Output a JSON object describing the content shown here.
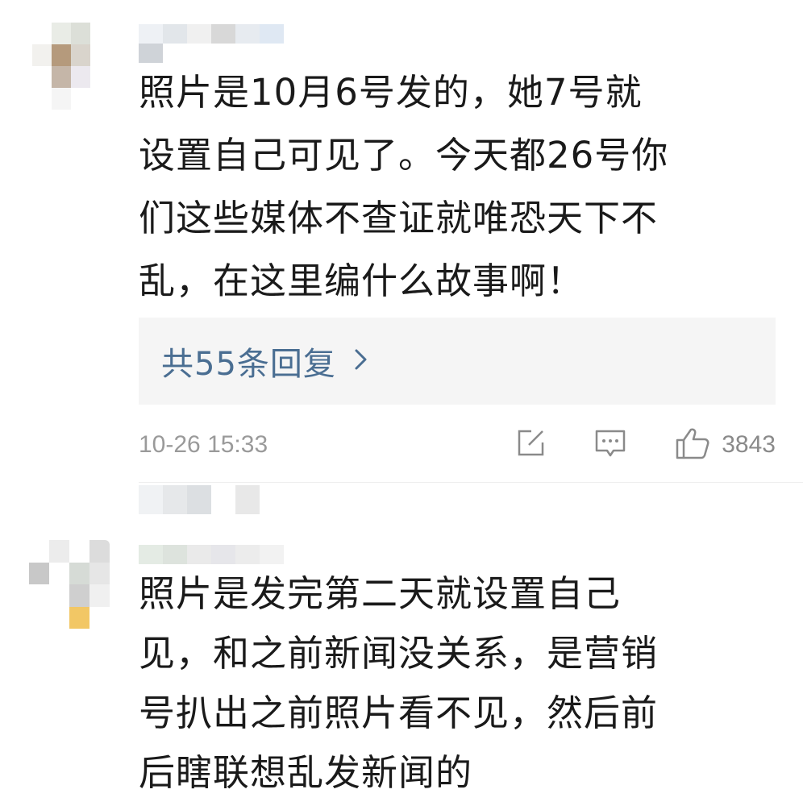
{
  "comments": [
    {
      "text": "照片是10月6号发的，她7号就设置自己可见了。今天都26号你们这些媒体不查证就唯恐天下不乱，在这里编什么故事啊！",
      "lines": [
        "照片是10月6号发的，她7号就",
        "设置自己可见了。今天都26号你",
        "们这些媒体不查证就唯恐天下不",
        "乱，在这里编什么故事啊！"
      ],
      "reply_link": "共55条回复",
      "timestamp": "10-26 15:33",
      "like_count": "3843"
    },
    {
      "text": "照片是发完第二天就设置自己见，和之前新闻没关系，是营销号扒出之前照片看不见，然后前后瞎联想乱发新闻的",
      "lines": [
        "照片是发完第二天就设置自己",
        "见，和之前新闻没关系，是营销",
        "号扒出之前照片看不见，然后前",
        "后瞎联想乱发新闻的"
      ]
    }
  ],
  "icons": {
    "share": "share-icon",
    "comment": "comment-icon",
    "like": "thumbs-up-icon",
    "reply_chevron": "chevron-right-icon"
  },
  "colors": {
    "text": "#1a1a1a",
    "link": "#4a6e92",
    "meta": "#9a9a9a",
    "reply_bg": "#f5f5f5"
  }
}
